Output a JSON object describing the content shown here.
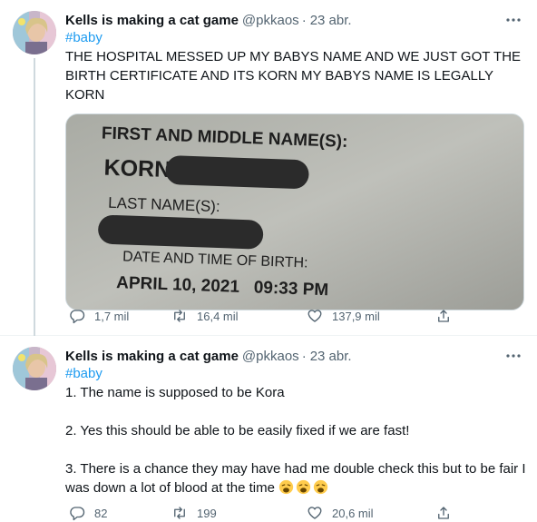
{
  "tweets": [
    {
      "author_name": "Kells is making a cat game",
      "handle": "@pkkaos",
      "separator": "·",
      "date": "23 abr.",
      "hashtag": "#baby",
      "text": "THE HOSPITAL MESSED UP MY BABYS NAME AND WE JUST GOT THE BIRTH CERTIFICATE AND ITS KORN MY BABYS NAME IS LEGALLY KORN",
      "image": {
        "first_middle_label": "FIRST AND MIDDLE NAME(S):",
        "first_name": "KORN",
        "last_name_label": "LAST NAME(S):",
        "dob_label": "DATE AND TIME OF BIRTH:",
        "dob_value": "APRIL 10, 2021   09:33 PM"
      },
      "replies": "1,7 mil",
      "retweets": "16,4 mil",
      "likes": "137,9 mil"
    },
    {
      "author_name": "Kells is making a cat game",
      "handle": "@pkkaos",
      "separator": "·",
      "date": "23 abr.",
      "hashtag": "#baby",
      "line1": "1. The name is supposed to be Kora",
      "line2": "2. Yes this should be able to be easily fixed if we are fast!",
      "line3": "3. There is a chance they may have had me double check this but to be fair I was down a lot of blood at the time",
      "replies": "82",
      "retweets": "199",
      "likes": "20,6 mil"
    }
  ],
  "colors": {
    "accent": "#1d9bf0",
    "secondary_text": "#536471"
  },
  "icons": [
    "reply-icon",
    "retweet-icon",
    "like-icon",
    "share-icon",
    "more-icon",
    "weary-face-emoji"
  ]
}
